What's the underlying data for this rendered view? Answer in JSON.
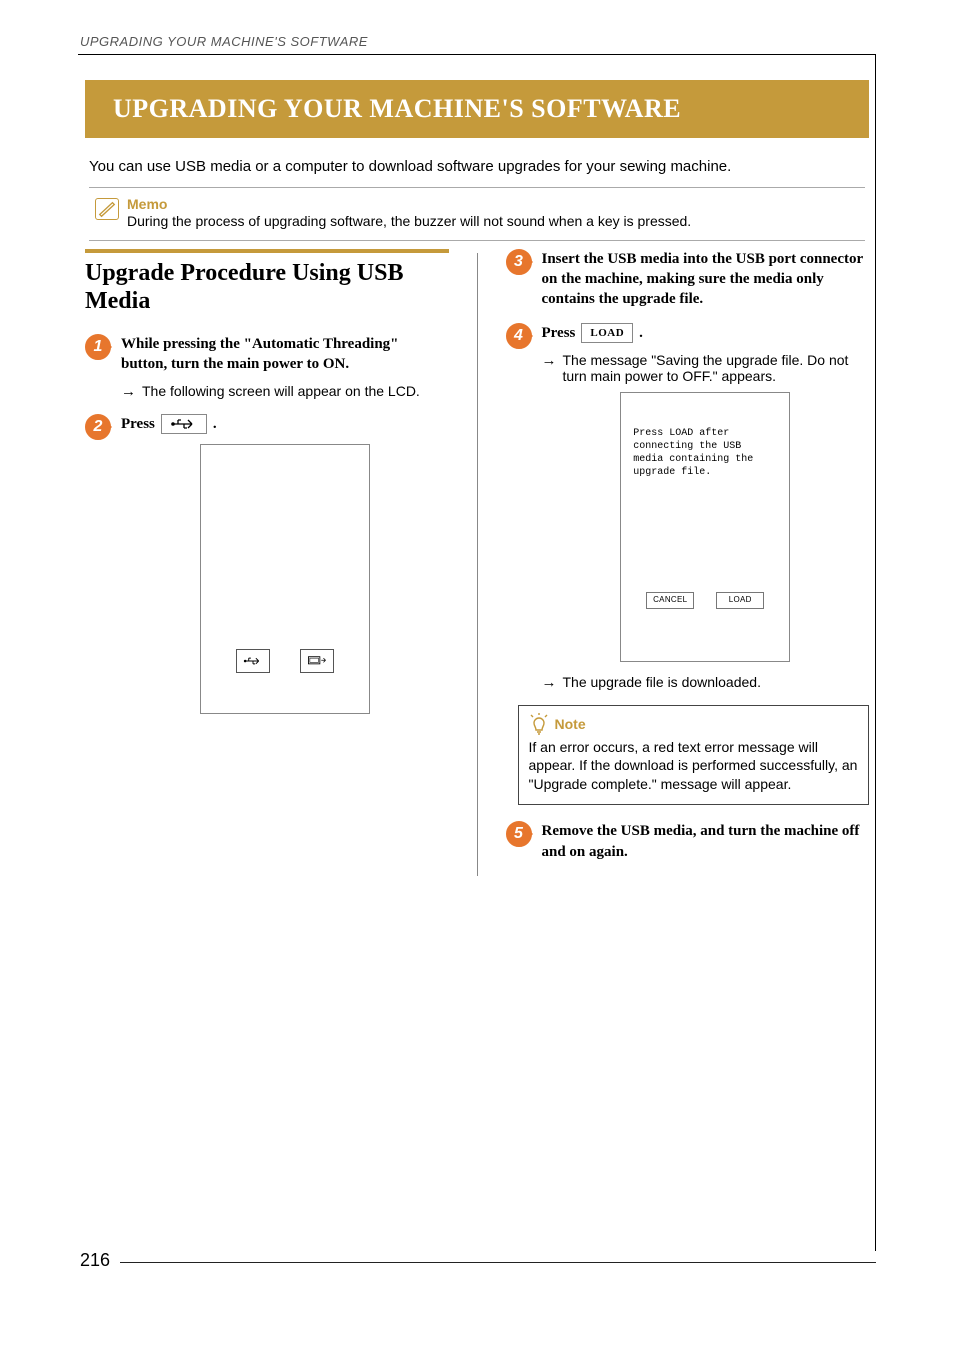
{
  "running_head": "UPGRADING YOUR MACHINE'S SOFTWARE",
  "title": "UPGRADING YOUR MACHINE'S SOFTWARE",
  "intro": "You can use USB media or a computer to download software upgrades for your sewing machine.",
  "memo": {
    "label": "Memo",
    "text": "During the process of upgrading software, the buzzer will not sound when a key is pressed."
  },
  "section_title": "Upgrade Procedure Using USB Media",
  "steps": {
    "s1": {
      "num": "1",
      "title": "While pressing the \"Automatic Threading\" button, turn the main power to ON.",
      "sub": "The following screen will appear on the LCD."
    },
    "s2": {
      "num": "2",
      "press": "Press",
      "period": "."
    },
    "s3": {
      "num": "3",
      "title": "Insert the USB media into the USB port connector on the machine, making sure the media only contains the upgrade file."
    },
    "s4": {
      "num": "4",
      "press": "Press",
      "btn": "LOAD",
      "period": ".",
      "sub": "The message \"Saving the upgrade file. Do not turn main power to OFF.\" appears.",
      "lcd_text": "Press LOAD after connecting the USB media containing the upgrade file.",
      "lcd_cancel": "CANCEL",
      "lcd_load": "LOAD",
      "sub2": "The upgrade file is downloaded."
    },
    "note": {
      "label": "Note",
      "text": "If an error occurs, a red text error message will appear. If the download is performed successfully, an \"Upgrade complete.\" message will appear."
    },
    "s5": {
      "num": "5",
      "title": "Remove the USB media, and turn the machine off and on again."
    }
  },
  "page_number": "216"
}
